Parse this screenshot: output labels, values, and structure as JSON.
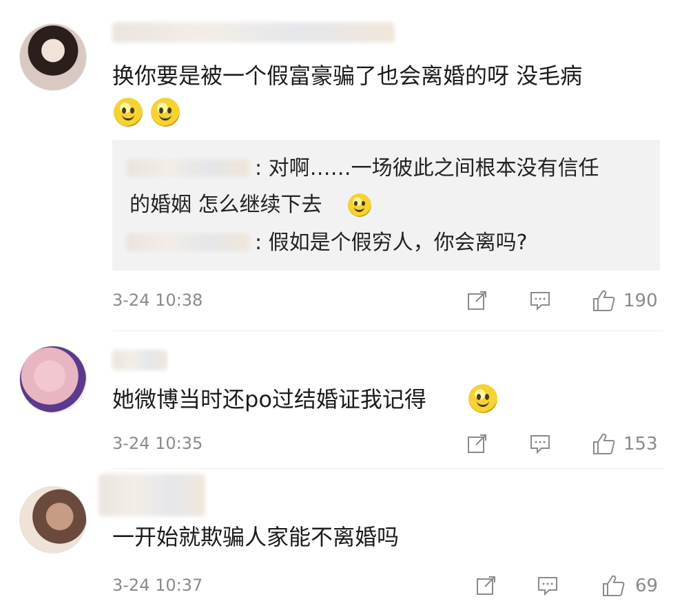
{
  "comments": [
    {
      "text": "换你要是被一个假富豪骗了也会离婚的呀 没毛病",
      "emojis": [
        "smile-emoji",
        "smile-emoji"
      ],
      "replies": [
        {
          "text": ": 对啊……一场彼此之间根本没有信任"
        },
        {
          "text": "的婚姻 怎么继续下去"
        },
        {
          "text": ": 假如是个假穷人，你会离吗?"
        }
      ],
      "time": "3-24 10:38",
      "likes": "190"
    },
    {
      "text": "她微博当时还po过结婚证我记得",
      "time": "3-24 10:35",
      "likes": "153"
    },
    {
      "text": "一开始就欺骗人家能不离婚吗",
      "time": "3-24 10:37",
      "likes": "69"
    }
  ],
  "icons": {
    "share": "share-icon",
    "reply": "comment-icon",
    "like": "thumbs-up-icon"
  }
}
